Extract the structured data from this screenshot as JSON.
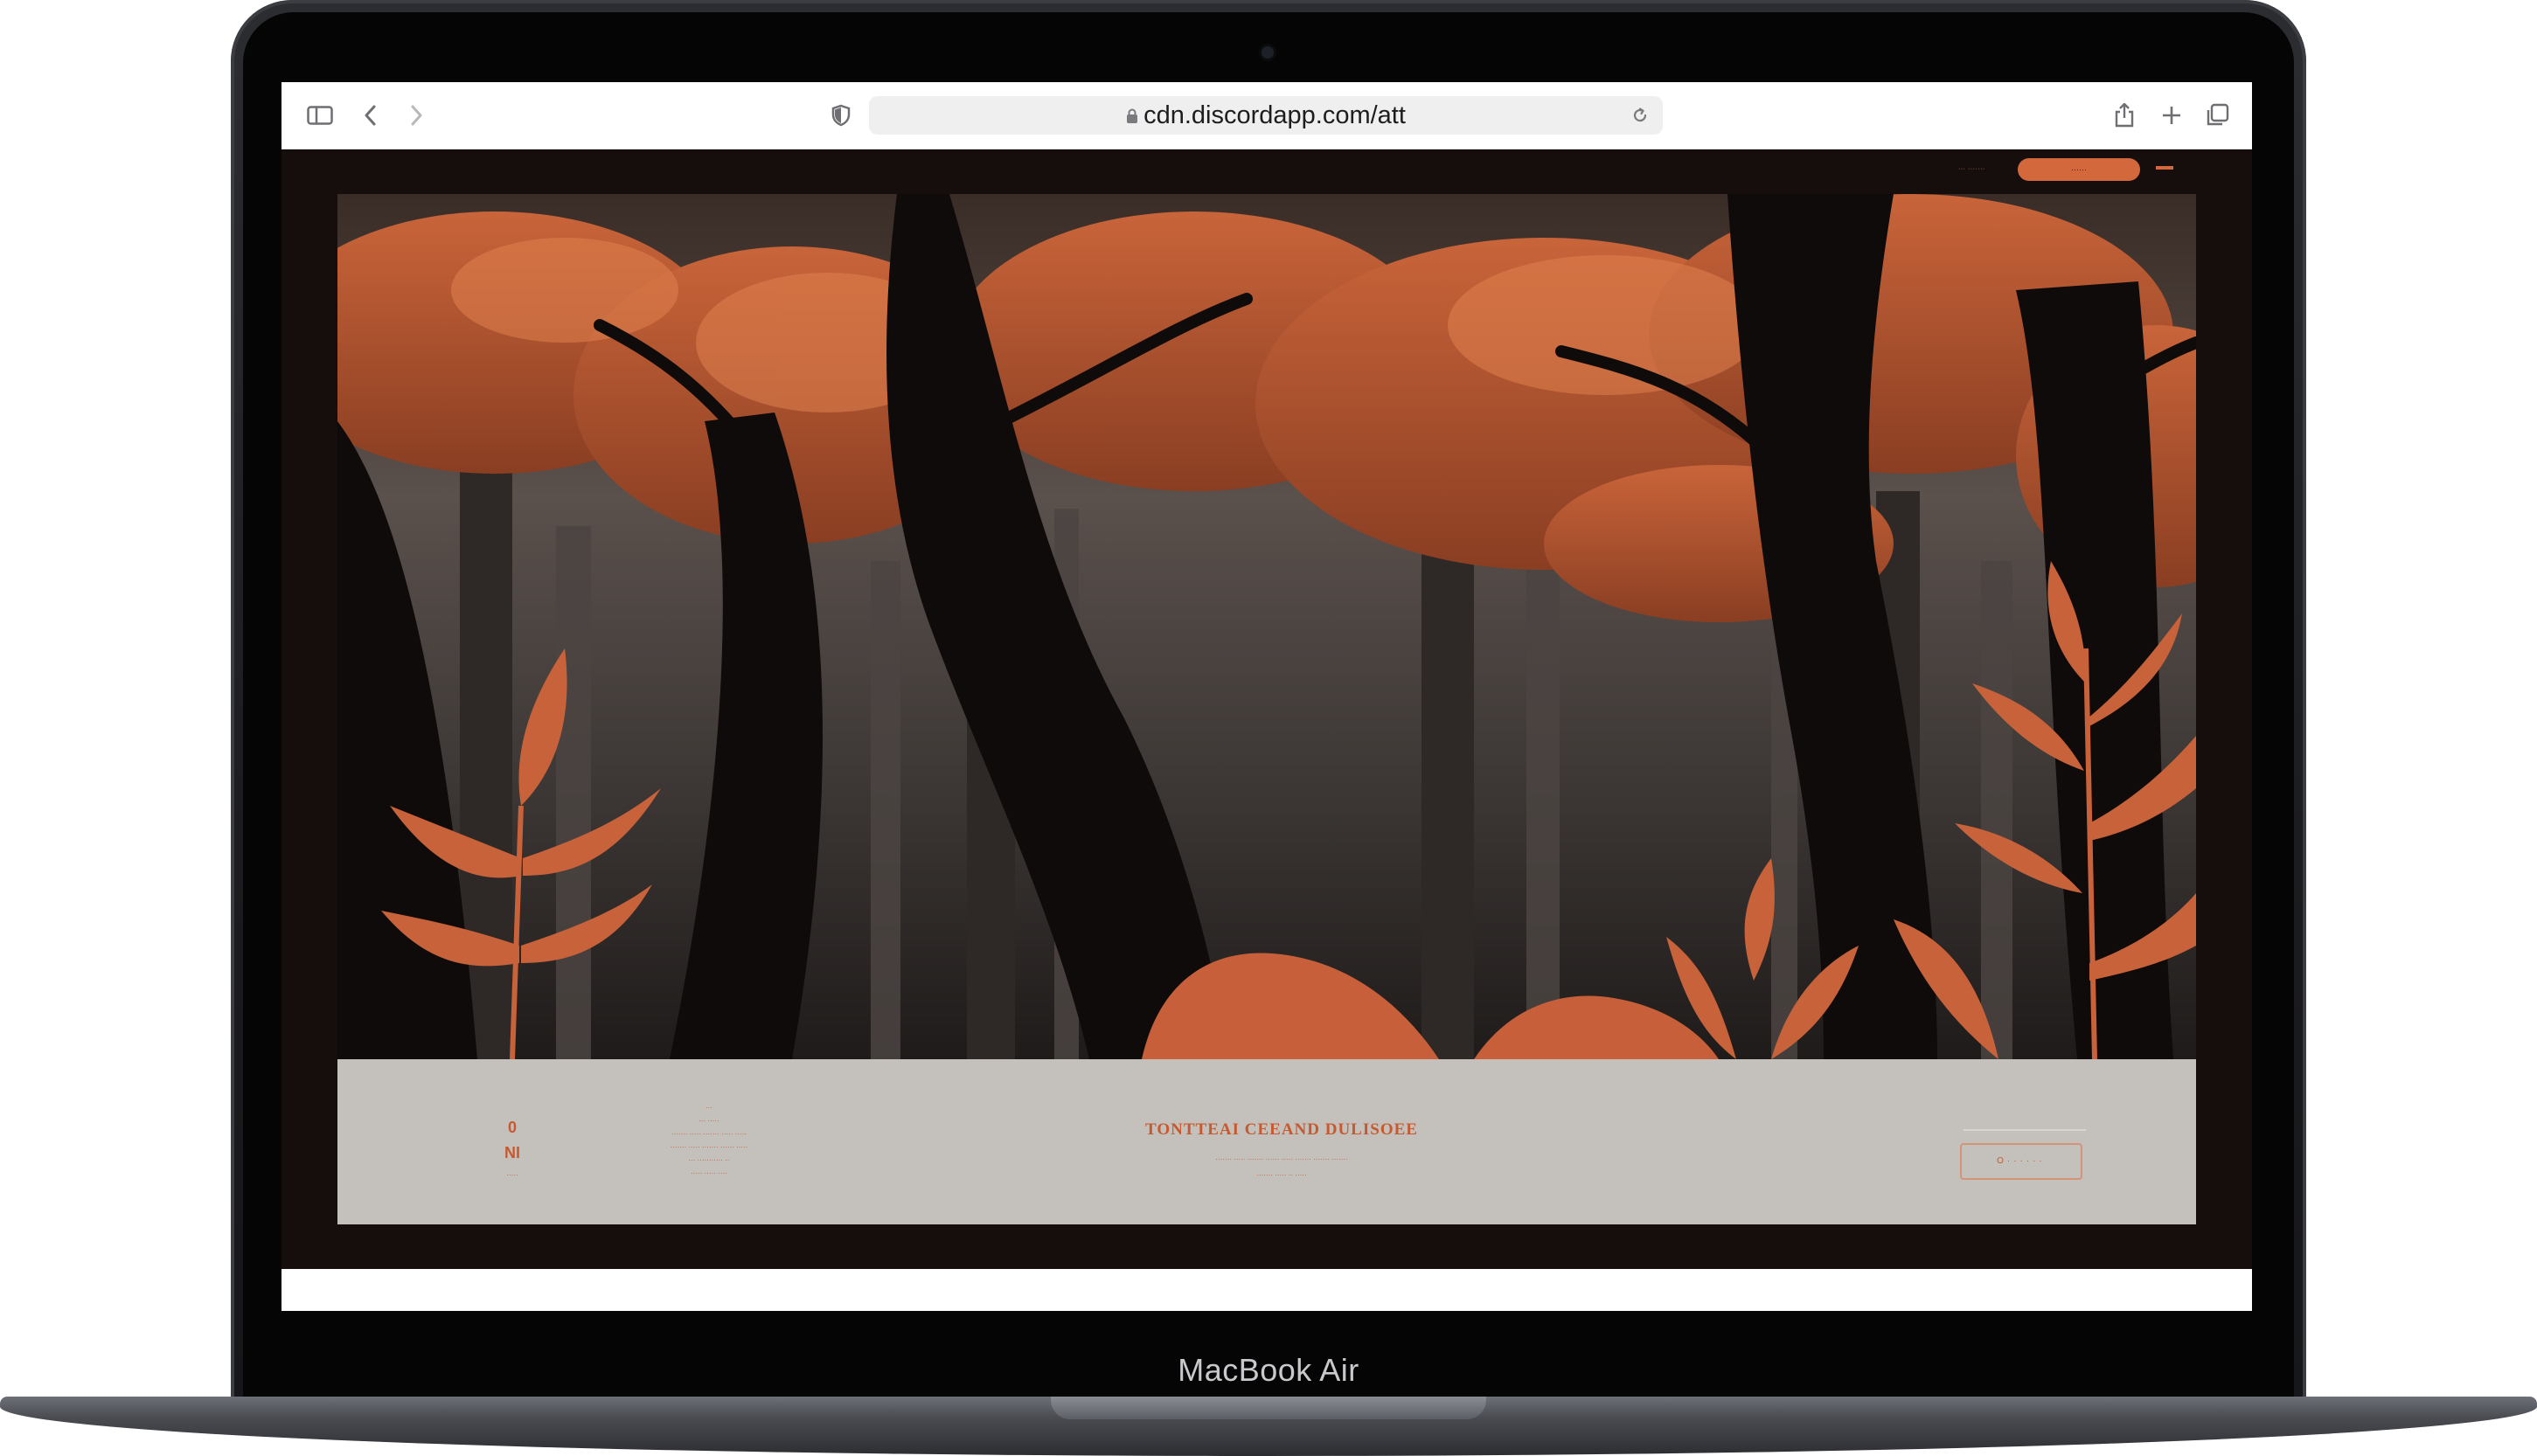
{
  "device": {
    "label": "MacBook Air"
  },
  "browser": {
    "url": "cdn.discordapp.com/att",
    "icons": {
      "sidebar": "sidebar-icon",
      "back": "chevron-left-icon",
      "forward": "chevron-right-icon",
      "privacy": "shield-icon",
      "lock": "lock-icon",
      "reload": "reload-icon",
      "share": "share-icon",
      "new_tab": "plus-icon",
      "tabs": "tab-overview-icon"
    }
  },
  "page": {
    "nav": {
      "small_text": "··· ·······",
      "cta_label": "······"
    },
    "hero": {
      "description": "Illustration of a dark forest with orange autumn foliage"
    },
    "info": {
      "stat_number": "0",
      "stat_letters": "NI",
      "stat_caption": "·····",
      "middle_lines": [
        "···",
        "··· ·····",
        "······· ····· ······· ····· ·····",
        "······· ····· ······· ······ ·····",
        "··· ··········· ··",
        "····· ····· ····"
      ],
      "headline": "TONTTEAI CEEAND DULISOEE",
      "body_lines": [
        "······· ····· ······· ······ ····· ······· ······· ·······",
        "······· ····· ·· ·····"
      ],
      "button_label": "O······"
    },
    "colors": {
      "accent": "#d4683d",
      "band": "#c4c0bb",
      "page_bg": "#150e0c"
    }
  }
}
